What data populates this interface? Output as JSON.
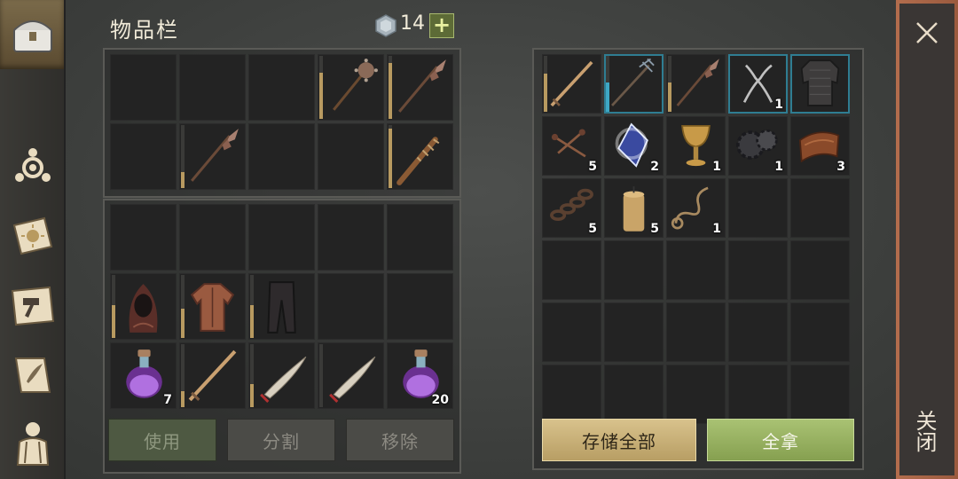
{
  "header": {
    "title": "物品栏",
    "currency": "14",
    "add_label": "+"
  },
  "buttons": {
    "use": "使用",
    "split": "分割",
    "remove": "移除",
    "store_all": "存储全部",
    "take_all": "全拿"
  },
  "close": {
    "label": "关闭"
  },
  "sidebar": [
    "chest-icon",
    "gathering-icon",
    "journal-icon",
    "crafting-icon",
    "scroll-icon",
    "character-icon"
  ],
  "inventory_top": [
    {
      "icon": ""
    },
    {
      "icon": ""
    },
    {
      "icon": ""
    },
    {
      "icon": "mace",
      "dura": 0.75
    },
    {
      "icon": "spear",
      "dura": 0.9
    },
    {
      "icon": ""
    },
    {
      "icon": "spear",
      "dura": 0.3
    },
    {
      "icon": ""
    },
    {
      "icon": ""
    },
    {
      "icon": "spiked-club",
      "dura": 0.95
    }
  ],
  "inventory_bottom": [
    {
      "icon": ""
    },
    {
      "icon": ""
    },
    {
      "icon": ""
    },
    {
      "icon": ""
    },
    {
      "icon": ""
    },
    {
      "icon": "hood",
      "dura": 0.55
    },
    {
      "icon": "shirt",
      "dura": 0.5
    },
    {
      "icon": "pants",
      "dura": 0.55
    },
    {
      "icon": ""
    },
    {
      "icon": ""
    },
    {
      "icon": "potion",
      "qty": "7"
    },
    {
      "icon": "sword",
      "dura": 0.3
    },
    {
      "icon": "saber",
      "dura": 0.4
    },
    {
      "icon": "saber",
      "dura": 0.05
    },
    {
      "icon": "potion",
      "qty": "20"
    }
  ],
  "storage": [
    {
      "icon": "sword",
      "dura": 0.7
    },
    {
      "icon": "trident",
      "dura": 0.55,
      "sel": true
    },
    {
      "icon": "spear",
      "dura": 0.55
    },
    {
      "icon": "pliers",
      "qty": "1",
      "sel": true
    },
    {
      "icon": "armor",
      "sel": true
    },
    {
      "icon": "nails",
      "qty": "5"
    },
    {
      "icon": "crystal",
      "qty": "2"
    },
    {
      "icon": "chalice",
      "qty": "1"
    },
    {
      "icon": "gears",
      "qty": "1"
    },
    {
      "icon": "leather",
      "qty": "3"
    },
    {
      "icon": "chain",
      "qty": "5"
    },
    {
      "icon": "candle",
      "qty": "5"
    },
    {
      "icon": "rope",
      "qty": "1"
    },
    {
      "icon": ""
    },
    {
      "icon": ""
    },
    {
      "icon": ""
    },
    {
      "icon": ""
    },
    {
      "icon": ""
    },
    {
      "icon": ""
    },
    {
      "icon": ""
    },
    {
      "icon": ""
    },
    {
      "icon": ""
    },
    {
      "icon": ""
    },
    {
      "icon": ""
    },
    {
      "icon": ""
    },
    {
      "icon": ""
    },
    {
      "icon": ""
    },
    {
      "icon": ""
    },
    {
      "icon": ""
    },
    {
      "icon": ""
    }
  ],
  "colors": {
    "durability": "#b89a60",
    "selected": "#3ea7c4",
    "store_btn": "#c9b07a",
    "take_btn": "#96b060"
  }
}
